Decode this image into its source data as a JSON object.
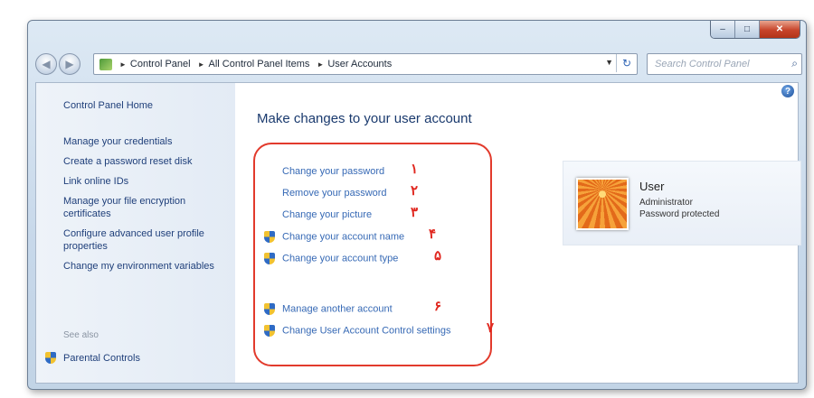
{
  "window": {
    "caption": {
      "minimize": "–",
      "maximize": "□",
      "close": "✕"
    }
  },
  "nav": {
    "back": "◀",
    "forward": "▶",
    "breadcrumb": [
      "Control Panel",
      "All Control Panel Items",
      "User Accounts"
    ],
    "separator": "►",
    "dropdown": "▼",
    "refresh": "↻",
    "search_placeholder": "Search Control Panel",
    "search_glyph": "⌕"
  },
  "help": "?",
  "sidebar": {
    "home": "Control Panel Home",
    "links": [
      "Manage your credentials",
      "Create a password reset disk",
      "Link online IDs",
      "Manage your file encryption certificates",
      "Configure advanced user profile properties",
      "Change my environment variables"
    ],
    "see_also": "See also",
    "parental": "Parental Controls"
  },
  "main": {
    "title": "Make changes to your user account",
    "tasks": [
      "Change your password",
      "Remove your password",
      "Change your picture",
      "Change your account name",
      "Change your account type",
      "Manage another account",
      "Change User Account Control settings"
    ],
    "markers": [
      "۱",
      "۲",
      "۳",
      "۴",
      "۵",
      "۶",
      "۷"
    ]
  },
  "user": {
    "name": "User",
    "role": "Administrator",
    "status": "Password protected"
  },
  "colors": {
    "link": "#3669b5",
    "annotation": "#e0271f"
  }
}
